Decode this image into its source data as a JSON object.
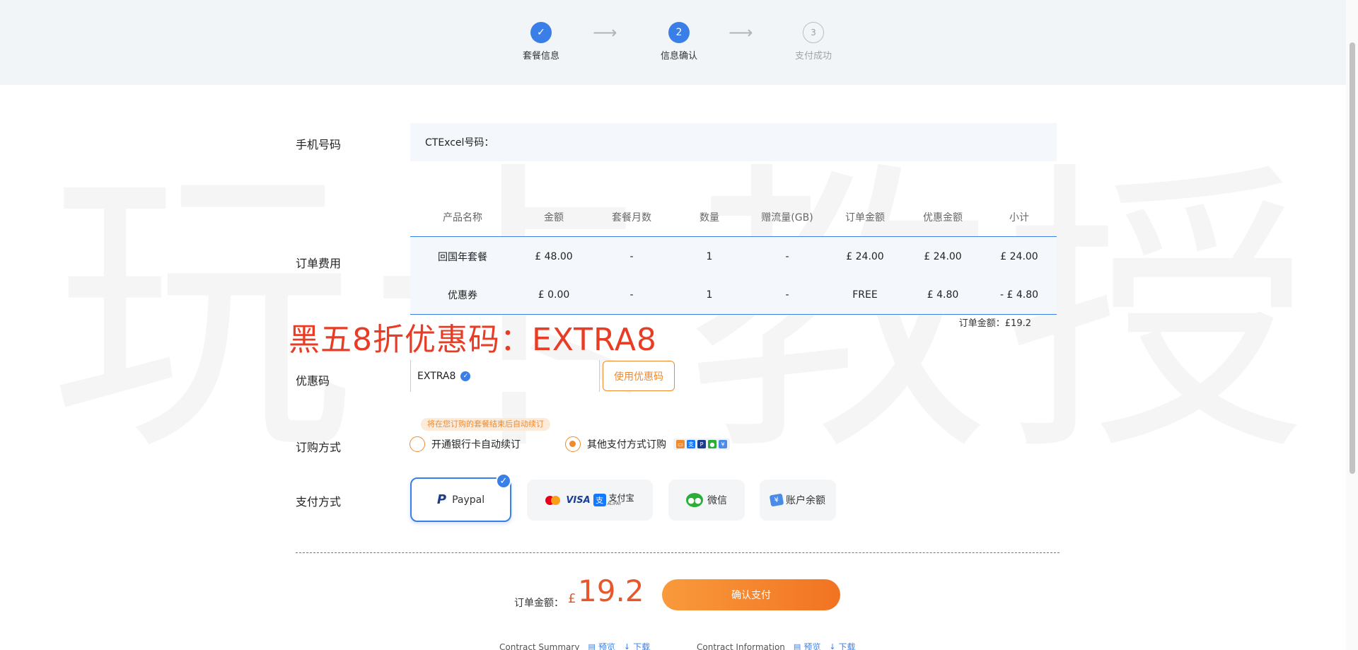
{
  "steps": [
    {
      "label": "套餐信息",
      "icon": "check-icon",
      "mark": "✓",
      "status": "done"
    },
    {
      "label": "信息确认",
      "mark": "2",
      "status": "active"
    },
    {
      "label": "支付成功",
      "mark": "3",
      "status": "pending"
    }
  ],
  "watermark": "玩卡教授",
  "phone": {
    "label": "手机号码",
    "value": "CTExcel号码："
  },
  "order": {
    "label": "订单费用",
    "columns": [
      "产品名称",
      "金额",
      "套餐月数",
      "数量",
      "赠流量(GB)",
      "订单金额",
      "优惠金额",
      "小计"
    ],
    "rows": [
      [
        "回国年套餐",
        "£ 48.00",
        "-",
        "1",
        "-",
        "£ 24.00",
        "£ 24.00",
        "£ 24.00"
      ],
      [
        "优惠券",
        "£ 0.00",
        "-",
        "1",
        "-",
        "FREE",
        "£ 4.80",
        "- £ 4.80"
      ]
    ],
    "total": "订单金额：£19.2"
  },
  "promo_banner": "黑五8折优惠码：EXTRA8",
  "coupon": {
    "label": "优惠码",
    "value": "EXTRA8",
    "button": "使用优惠码"
  },
  "subscribe": {
    "label": "订购方式",
    "hint": "将在您订购的套餐结束后自动续订",
    "options": [
      {
        "label": "开通银行卡自动续订",
        "selected": false
      },
      {
        "label": "其他支付方式订购",
        "selected": true
      }
    ]
  },
  "payment": {
    "label": "支付方式",
    "methods": [
      {
        "name": "Paypal",
        "selected": true
      },
      {
        "name": "VISA",
        "extra": "支付宝",
        "extra_sub": "ALIPAY",
        "selected": false
      },
      {
        "name": "微信",
        "selected": false
      },
      {
        "name": "账户余额",
        "selected": false
      }
    ]
  },
  "summary": {
    "label": "订单金额：",
    "currency": "£",
    "amount": "19.2",
    "confirm": "确认支付"
  },
  "contracts": [
    {
      "title": "Contract Summary",
      "preview": "预览",
      "download": "下载"
    },
    {
      "title": "Contract Information",
      "preview": "预览",
      "download": "下载"
    }
  ],
  "colors": {
    "accent_blue": "#3a7ee8",
    "accent_orange": "#f08a2e",
    "promo_red": "#e93c25"
  }
}
